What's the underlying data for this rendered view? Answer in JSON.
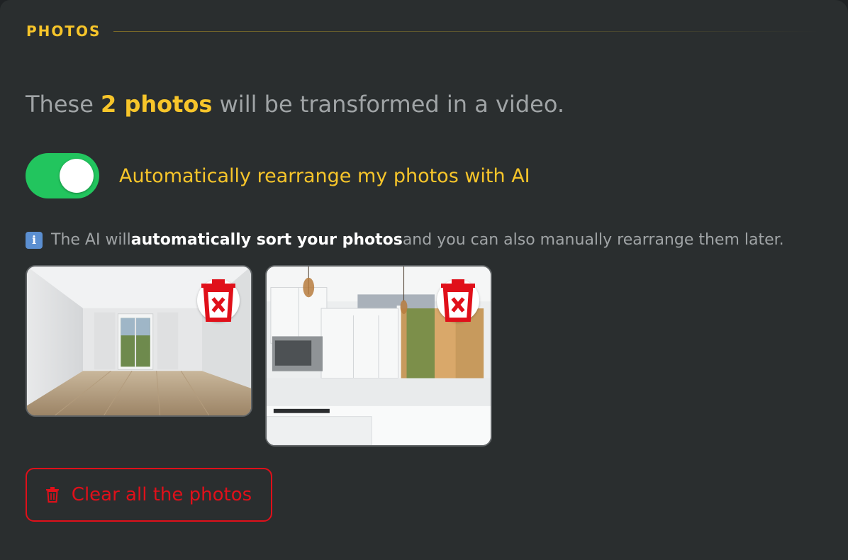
{
  "section": {
    "title": "PHOTOS"
  },
  "summary": {
    "prefix": "These ",
    "count_label": "2 photos",
    "suffix": " will be transformed in a video."
  },
  "ai_toggle": {
    "label": "Automatically rearrange my photos with AI",
    "enabled": true
  },
  "info": {
    "icon": "information-icon",
    "icon_glyph": "i",
    "prefix": "The AI will ",
    "emphasis": "automatically sort your photos",
    "suffix": " and you can also manually rearrange them later."
  },
  "photos": [
    {
      "subject": "empty-room-photo",
      "delete_icon": "trash-icon"
    },
    {
      "subject": "kitchen-photo",
      "delete_icon": "trash-icon"
    }
  ],
  "clear_button": {
    "label": "Clear all the photos",
    "icon": "trash-icon"
  },
  "colors": {
    "accent": "#f7c52a",
    "toggle_on": "#22c55e",
    "danger": "#e0101a",
    "panel_bg": "#2a2e2f",
    "muted_text": "#a0a4a6"
  }
}
